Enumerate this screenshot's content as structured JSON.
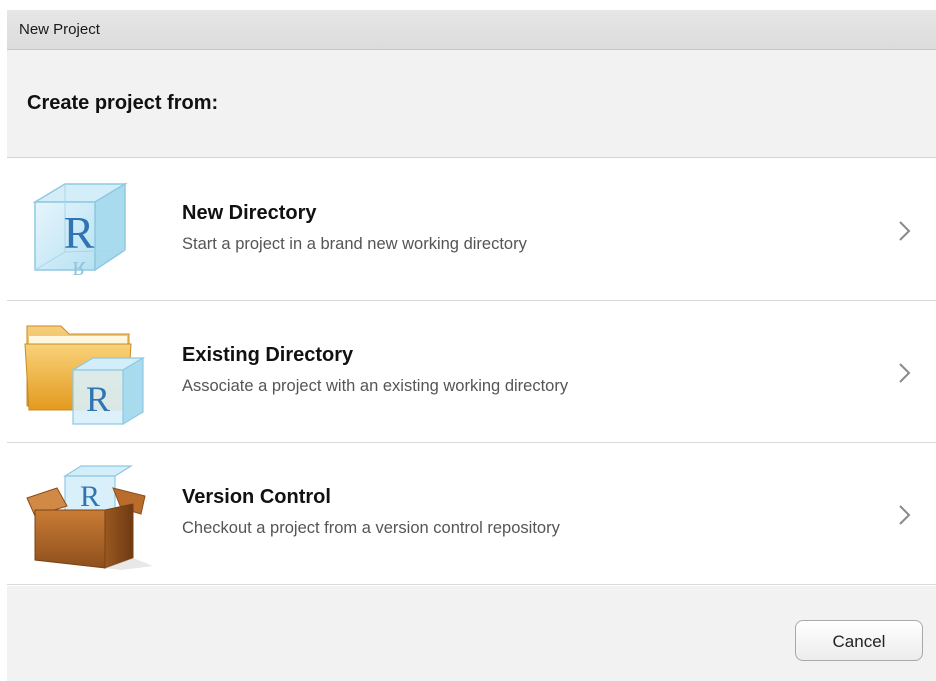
{
  "window": {
    "title": "New Project"
  },
  "header": {
    "title": "Create project from:"
  },
  "options": [
    {
      "title": "New Directory",
      "description": "Start a project in a brand new working directory",
      "icon": "r-cube-icon"
    },
    {
      "title": "Existing Directory",
      "description": "Associate a project with an existing working directory",
      "icon": "folder-r-cube-icon"
    },
    {
      "title": "Version Control",
      "description": "Checkout a project from a version control repository",
      "icon": "box-r-cube-icon"
    }
  ],
  "footer": {
    "cancel_label": "Cancel"
  },
  "colors": {
    "header_bg": "#f2f2f2",
    "cube_blue": "#9fd3ea",
    "r_letter": "#2f74b3",
    "folder": "#f2b640",
    "box": "#b0682a"
  }
}
